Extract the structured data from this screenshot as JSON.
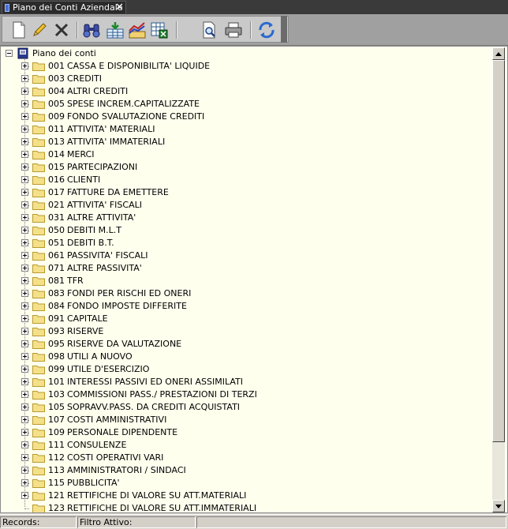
{
  "tab": {
    "title": "Piano dei Conti Aziendale",
    "close": "✕"
  },
  "tree": {
    "root_label": "Piano dei conti",
    "items": [
      {
        "code": "001",
        "name": "CASSA E DISPONIBILITA' LIQUIDE"
      },
      {
        "code": "003",
        "name": "CREDITI"
      },
      {
        "code": "004",
        "name": "ALTRI CREDITI"
      },
      {
        "code": "005",
        "name": "SPESE INCREM.CAPITALIZZATE"
      },
      {
        "code": "009",
        "name": "FONDO SVALUTAZIONE CREDITI"
      },
      {
        "code": "011",
        "name": "ATTIVITA' MATERIALI"
      },
      {
        "code": "013",
        "name": "ATTIVITA' IMMATERIALI"
      },
      {
        "code": "014",
        "name": "MERCI"
      },
      {
        "code": "015",
        "name": "PARTECIPAZIONI"
      },
      {
        "code": "016",
        "name": "CLIENTI"
      },
      {
        "code": "017",
        "name": "FATTURE DA EMETTERE"
      },
      {
        "code": "021",
        "name": "ATTIVITA' FISCALI"
      },
      {
        "code": "031",
        "name": "ALTRE ATTIVITA'"
      },
      {
        "code": "050",
        "name": "DEBITI M.L.T"
      },
      {
        "code": "051",
        "name": "DEBITI B.T."
      },
      {
        "code": "061",
        "name": "PASSIVITA' FISCALI"
      },
      {
        "code": "071",
        "name": "ALTRE PASSIVITA'"
      },
      {
        "code": "081",
        "name": "TFR"
      },
      {
        "code": "083",
        "name": "FONDI PER RISCHI ED ONERI"
      },
      {
        "code": "084",
        "name": "FONDO IMPOSTE DIFFERITE"
      },
      {
        "code": "091",
        "name": "CAPITALE"
      },
      {
        "code": "093",
        "name": "RISERVE"
      },
      {
        "code": "095",
        "name": "RISERVE DA VALUTAZIONE"
      },
      {
        "code": "098",
        "name": "UTILI A NUOVO"
      },
      {
        "code": "099",
        "name": "UTILE D'ESERCIZIO"
      },
      {
        "code": "101",
        "name": "INTERESSI PASSIVI ED ONERI ASSIMILATI"
      },
      {
        "code": "103",
        "name": "COMMISSIONI PASS./ PRESTAZIONI DI TERZI"
      },
      {
        "code": "105",
        "name": "SOPRAVV.PASS. DA CREDITI ACQUISTATI"
      },
      {
        "code": "107",
        "name": "COSTI AMMINISTRATIVI"
      },
      {
        "code": "109",
        "name": "PERSONALE DIPENDENTE"
      },
      {
        "code": "111",
        "name": "CONSULENZE"
      },
      {
        "code": "112",
        "name": "COSTI OPERATIVI VARI"
      },
      {
        "code": "113",
        "name": "AMMINISTRATORI / SINDACI"
      },
      {
        "code": "115",
        "name": "PUBBLICITA'"
      },
      {
        "code": "121",
        "name": "RETTIFICHE DI VALORE SU ATT.MATERIALI"
      },
      {
        "code": "123",
        "name": "RETTIFICHE DI VALORE SU ATT.IMMATERIALI"
      }
    ]
  },
  "status": {
    "records": "Records:",
    "filter": "Filtro Attivo:"
  },
  "colors": {
    "tree_bg": "#ffffee",
    "folder": "#f5e08a",
    "folder_edge": "#b89a2c"
  }
}
